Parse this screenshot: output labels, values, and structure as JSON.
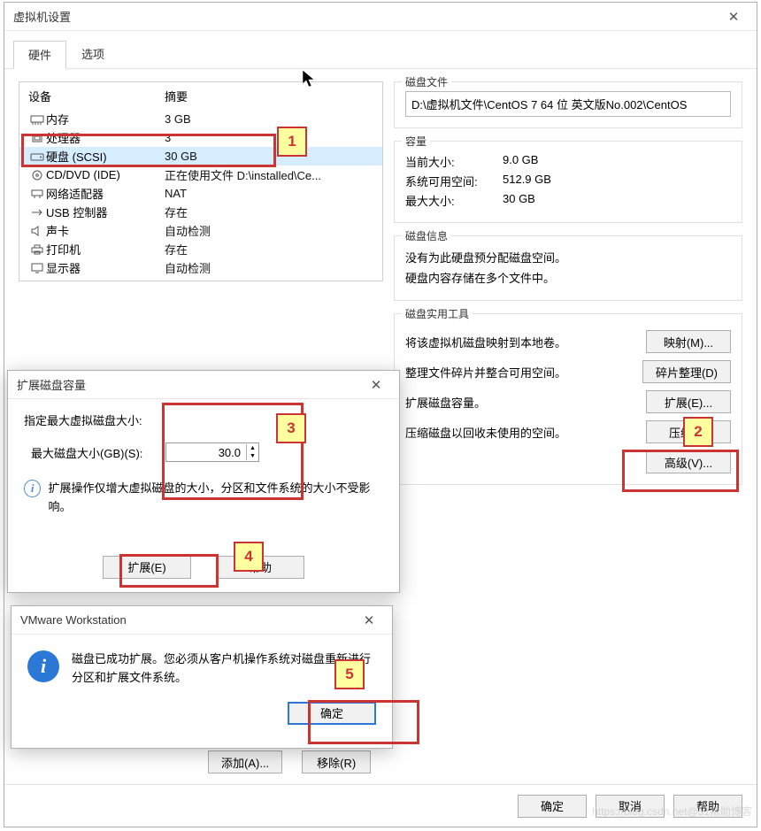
{
  "main_window": {
    "title": "虚拟机设置",
    "tabs": {
      "hardware": "硬件",
      "options": "选项"
    },
    "hw_header": {
      "device": "设备",
      "summary": "摘要"
    },
    "hw": [
      {
        "icon": "memory",
        "name": "内存",
        "summary": "3 GB"
      },
      {
        "icon": "cpu",
        "name": "处理器",
        "summary": "3"
      },
      {
        "icon": "disk",
        "name": "硬盘 (SCSI)",
        "summary": "30 GB"
      },
      {
        "icon": "cd",
        "name": "CD/DVD (IDE)",
        "summary": "正在使用文件 D:\\installed\\Ce..."
      },
      {
        "icon": "net",
        "name": "网络适配器",
        "summary": "NAT"
      },
      {
        "icon": "usb",
        "name": "USB 控制器",
        "summary": "存在"
      },
      {
        "icon": "sound",
        "name": "声卡",
        "summary": "自动检测"
      },
      {
        "icon": "printer",
        "name": "打印机",
        "summary": "存在"
      },
      {
        "icon": "display",
        "name": "显示器",
        "summary": "自动检测"
      }
    ],
    "add_btn": "添加(A)...",
    "remove_btn": "移除(R)",
    "ok": "确定",
    "cancel": "取消",
    "help": "帮助"
  },
  "right": {
    "disk_file": {
      "title": "磁盘文件",
      "value": "D:\\虚拟机文件\\CentOS 7 64 位 英文版No.002\\CentOS"
    },
    "capacity": {
      "title": "容量",
      "current_k": "当前大小:",
      "current_v": "9.0 GB",
      "free_k": "系统可用空间:",
      "free_v": "512.9 GB",
      "max_k": "最大大小:",
      "max_v": "30 GB"
    },
    "disk_info": {
      "title": "磁盘信息",
      "line1": "没有为此硬盘预分配磁盘空间。",
      "line2": "硬盘内容存储在多个文件中。"
    },
    "tools": {
      "title": "磁盘实用工具",
      "map_desc": "将该虚拟机磁盘映射到本地卷。",
      "map_btn": "映射(M)...",
      "defrag_desc": "整理文件碎片并整合可用空间。",
      "defrag_btn": "碎片整理(D)",
      "expand_desc": "扩展磁盘容量。",
      "expand_btn": "扩展(E)...",
      "compact_desc": "压缩磁盘以回收未使用的空间。",
      "compact_btn": "压缩(C)",
      "advanced_btn": "高级(V)..."
    }
  },
  "expand_dialog": {
    "title": "扩展磁盘容量",
    "prompt": "指定最大虚拟磁盘大小:",
    "size_label": "最大磁盘大小(GB)(S):",
    "size_value": "30.0",
    "note": "扩展操作仅增大虚拟磁盘的大小，分区和文件系统的大小不受影响。",
    "expand_btn": "扩展(E)",
    "help_btn": "帮助"
  },
  "msg_dialog": {
    "title": "VMware Workstation",
    "text": "磁盘已成功扩展。您必须从客户机操作系统对磁盘重新进行分区和扩展文件系统。",
    "ok": "确定"
  },
  "callouts": {
    "c1": "1",
    "c2": "2",
    "c3": "3",
    "c4": "4",
    "c5": "5"
  },
  "watermark": "https://blog.csdn.net@51帮助博客"
}
